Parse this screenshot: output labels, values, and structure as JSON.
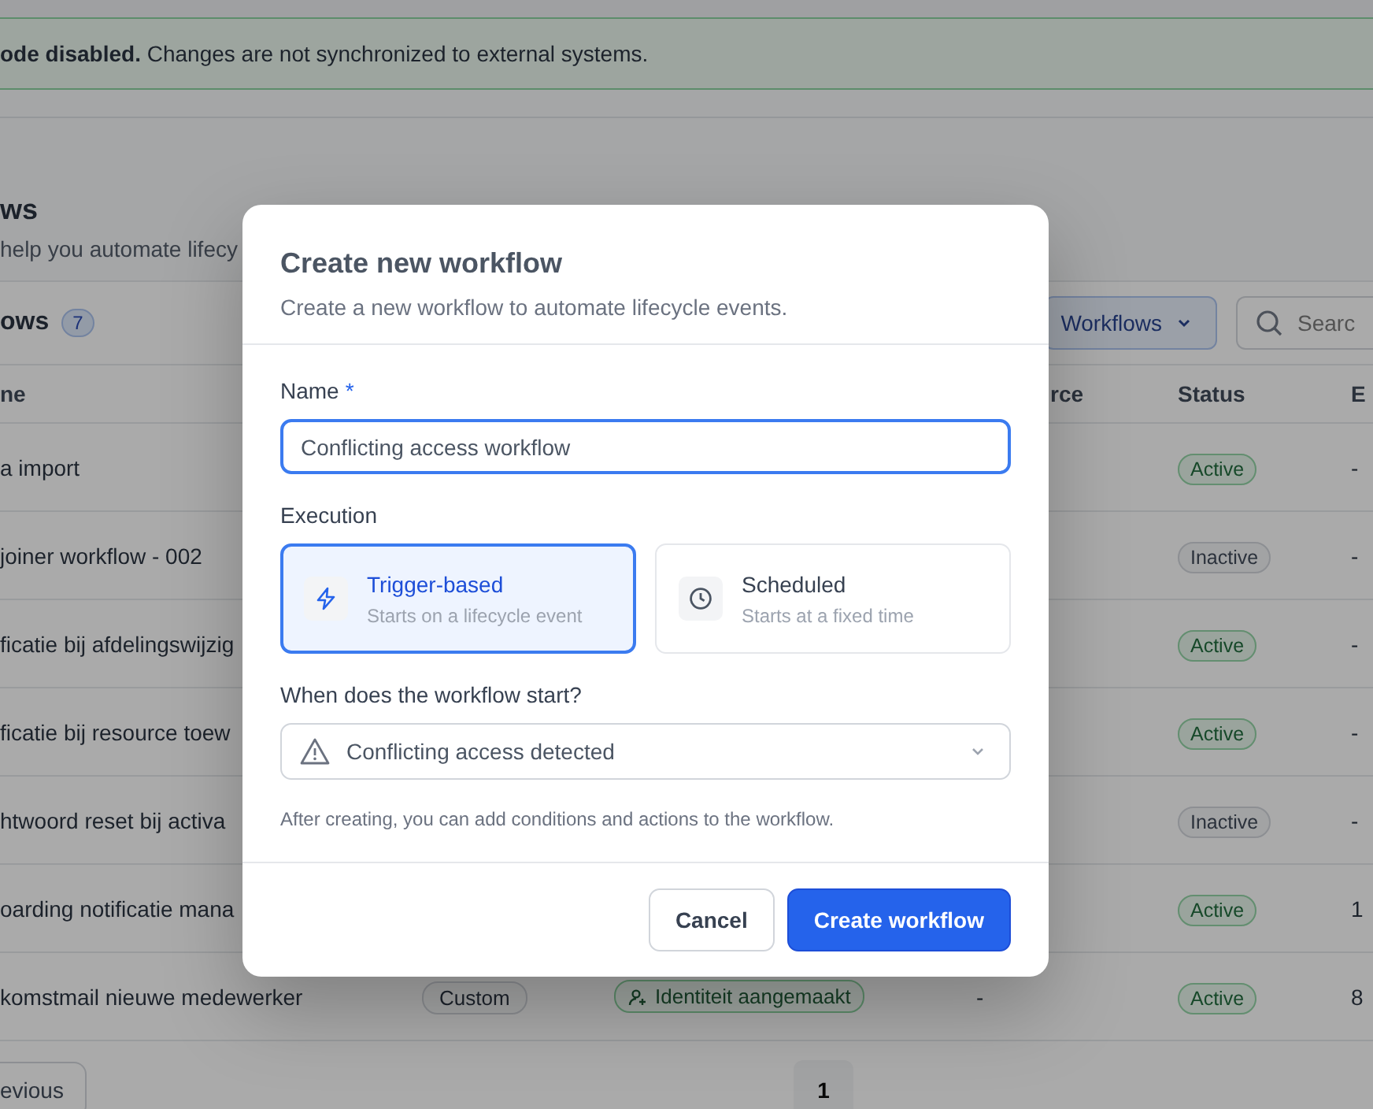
{
  "banner": {
    "text": "**ode disabled.** Changes are not synchronized to external systems."
  },
  "page": {
    "title": "ws",
    "subtitle": "help you automate lifecy"
  },
  "list": {
    "title": "ows",
    "count": "7",
    "filter": "Workflows",
    "search": {
      "placeholder": "Searc"
    }
  },
  "table": {
    "columns": [
      "ne",
      "",
      "",
      "rce",
      "Status",
      "E"
    ],
    "rows": [
      {
        "name": "a import",
        "status": "Active",
        "active": true,
        "executions": "-"
      },
      {
        "name": "joiner workflow - 002",
        "status": "Inactive",
        "active": false,
        "executions": "-"
      },
      {
        "name": "ficatie bij afdelingswijzig",
        "status": "Active",
        "active": true,
        "executions": "-"
      },
      {
        "name": "ficatie bij resource toew",
        "status": "Active",
        "active": true,
        "executions": "-"
      },
      {
        "name": "htwoord reset bij activa",
        "status": "Inactive",
        "active": false,
        "executions": "-"
      },
      {
        "name": "oarding notificatie mana",
        "status": "Active",
        "active": true,
        "executions": "1"
      },
      {
        "name": "komstmail nieuwe medewerker",
        "type": "Custom",
        "trigger": "Identiteit aangemaakt",
        "source": "-",
        "status": "Active",
        "active": true,
        "executions": "8"
      }
    ]
  },
  "pagination": {
    "previous": "evious",
    "pages": [
      {
        "label": "1",
        "selected": true
      }
    ]
  },
  "dialog": {
    "title": "Create new workflow",
    "subtitle": "Create a new workflow to automate lifecycle events.",
    "name_field": {
      "label": "Name",
      "required_mark": "*",
      "value": "Conflicting access workflow"
    },
    "execution": {
      "label": "Execution",
      "options": [
        {
          "kind": "trigger",
          "title": "Trigger-based",
          "description": "Starts on a lifecycle event",
          "selected": true
        },
        {
          "kind": "schedule",
          "title": "Scheduled",
          "description": "Starts at a fixed time",
          "selected": false
        }
      ]
    },
    "start": {
      "label": "When does the workflow start?",
      "value": "Conflicting access detected"
    },
    "hint": "After creating, you can add conditions and actions to the workflow.",
    "cancel": "Cancel",
    "submit": "Create workflow"
  }
}
